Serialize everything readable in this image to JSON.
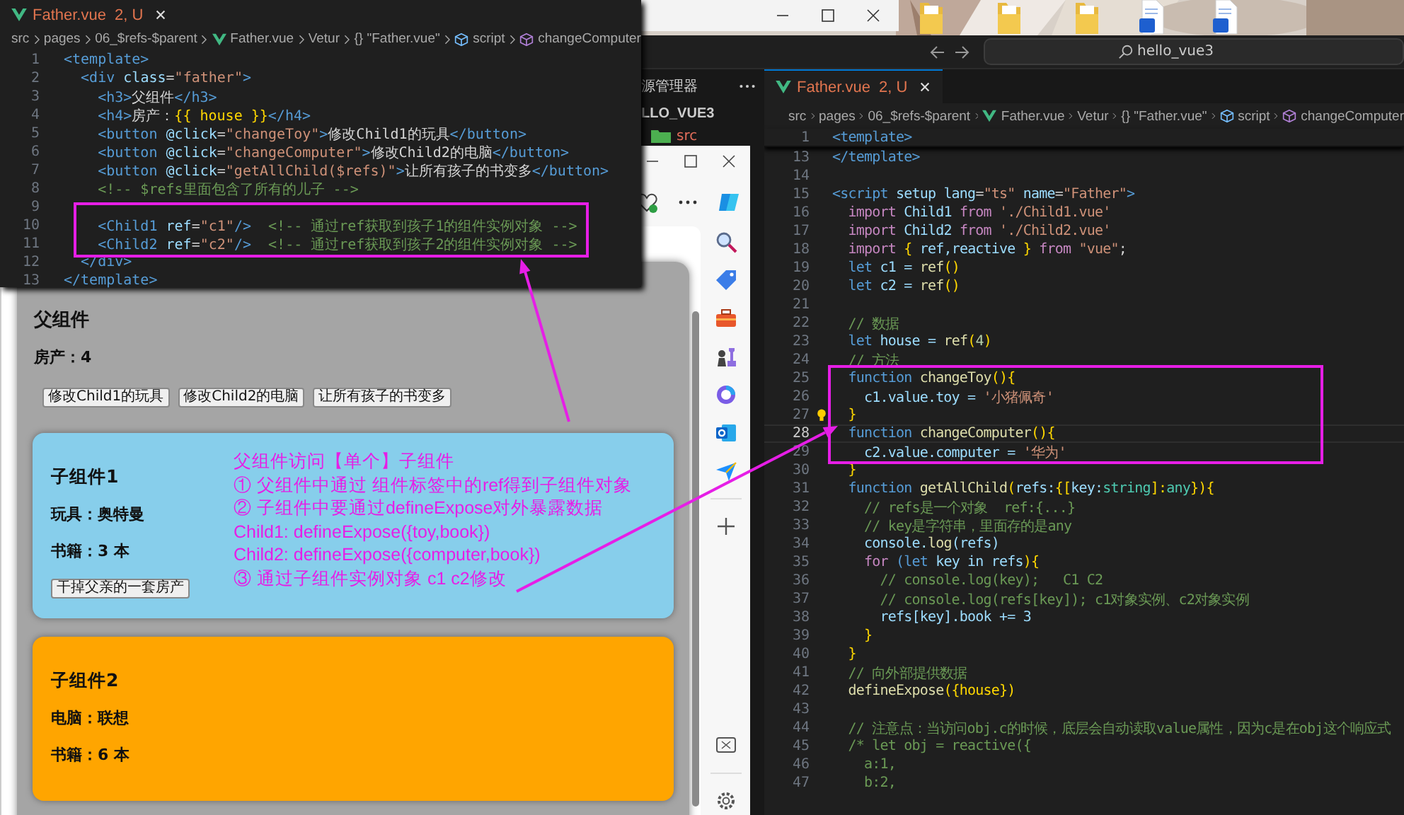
{
  "desktop_icons": [
    {
      "kind": "folder"
    },
    {
      "kind": "folder"
    },
    {
      "kind": "folder"
    },
    {
      "kind": "document"
    },
    {
      "kind": "document"
    }
  ],
  "vscode_window": {
    "search": "hello_vue3",
    "explorer": {
      "title": "源管理器",
      "project": "LLO_VUE3",
      "folder": "src"
    },
    "tab": {
      "name": "Father.vue",
      "status": "2, U"
    },
    "breadcrumb": [
      {
        "label": "src"
      },
      {
        "label": "pages"
      },
      {
        "label": "06_$refs-$parent"
      },
      {
        "label": "Father.vue",
        "kind": "vue"
      },
      {
        "label": "Vetur"
      },
      {
        "label": "{} \"Father.vue\""
      },
      {
        "label": "script",
        "kind": "script"
      },
      {
        "label": "changeComputer",
        "kind": "method"
      }
    ],
    "sticky_line": {
      "number": "1",
      "tokens": [
        {
          "text": "<template>",
          "kind": "tag"
        }
      ]
    },
    "lines": [
      {
        "number": "13",
        "active": false,
        "hint": false,
        "tokens": [
          {
            "text": "</template>",
            "kind": "tag"
          }
        ]
      },
      {
        "number": "14",
        "active": false,
        "hint": false
      },
      {
        "number": "15",
        "active": false,
        "hint": false,
        "tokens": [
          {
            "text": "<script ",
            "kind": "tag"
          },
          {
            "text": "setup lang",
            "kind": "attr"
          },
          {
            "text": "=",
            "kind": "text"
          },
          {
            "text": "\"ts\"",
            "kind": "str"
          },
          {
            "text": " name",
            "kind": "attr"
          },
          {
            "text": "=",
            "kind": "text"
          },
          {
            "text": "\"Father\"",
            "kind": "str"
          },
          {
            "text": ">",
            "kind": "tag"
          }
        ]
      },
      {
        "number": "16",
        "active": false,
        "hint": false,
        "tokens": [
          {
            "text": "  import ",
            "kind": "control"
          },
          {
            "text": "Child1 ",
            "kind": "var"
          },
          {
            "text": "from ",
            "kind": "control"
          },
          {
            "text": "'./Child1.vue'",
            "kind": "str"
          }
        ]
      },
      {
        "number": "17",
        "active": false,
        "hint": false,
        "tokens": [
          {
            "text": "  import ",
            "kind": "control"
          },
          {
            "text": "Child2 ",
            "kind": "var"
          },
          {
            "text": "from ",
            "kind": "control"
          },
          {
            "text": "'./Child2.vue'",
            "kind": "str"
          }
        ]
      },
      {
        "number": "18",
        "active": false,
        "hint": false,
        "tokens": [
          {
            "text": "  import ",
            "kind": "control"
          },
          {
            "text": "{ ",
            "kind": "brace"
          },
          {
            "text": "ref,reactive ",
            "kind": "var"
          },
          {
            "text": "} ",
            "kind": "brace"
          },
          {
            "text": "from ",
            "kind": "control"
          },
          {
            "text": "\"vue\"",
            "kind": "str"
          },
          {
            "text": ";",
            "kind": "text"
          }
        ]
      },
      {
        "number": "19",
        "active": false,
        "hint": false,
        "tokens": [
          {
            "text": "  let ",
            "kind": "keyword"
          },
          {
            "text": "c1 = ",
            "kind": "var"
          },
          {
            "text": "ref",
            "kind": "func"
          },
          {
            "text": "()",
            "kind": "brace"
          }
        ]
      },
      {
        "number": "20",
        "active": false,
        "hint": false,
        "tokens": [
          {
            "text": "  let ",
            "kind": "keyword"
          },
          {
            "text": "c2 = ",
            "kind": "var"
          },
          {
            "text": "ref",
            "kind": "func"
          },
          {
            "text": "()",
            "kind": "brace"
          }
        ]
      },
      {
        "number": "21",
        "active": false,
        "hint": false
      },
      {
        "number": "22",
        "active": false,
        "hint": false,
        "tokens": [
          {
            "text": "  // 数据",
            "kind": "comment"
          }
        ]
      },
      {
        "number": "23",
        "active": false,
        "hint": false,
        "tokens": [
          {
            "text": "  let ",
            "kind": "keyword"
          },
          {
            "text": "house = ",
            "kind": "var"
          },
          {
            "text": "ref",
            "kind": "func"
          },
          {
            "text": "(",
            "kind": "brace"
          },
          {
            "text": "4",
            "kind": "num"
          },
          {
            "text": ")",
            "kind": "brace"
          }
        ]
      },
      {
        "number": "24",
        "active": false,
        "hint": false,
        "tokens": [
          {
            "text": "  // 方法",
            "kind": "comment"
          }
        ]
      },
      {
        "number": "25",
        "active": false,
        "hint": false,
        "tokens": [
          {
            "text": "  function ",
            "kind": "keyword"
          },
          {
            "text": "changeToy",
            "kind": "func"
          },
          {
            "text": "(){",
            "kind": "brace"
          }
        ]
      },
      {
        "number": "26",
        "active": false,
        "hint": false,
        "tokens": [
          {
            "text": "    c1.value.toy = ",
            "kind": "var"
          },
          {
            "text": "'小猪佩奇'",
            "kind": "str"
          }
        ]
      },
      {
        "number": "27",
        "active": false,
        "hint": true,
        "tokens": [
          {
            "text": "  }",
            "kind": "brace"
          }
        ]
      },
      {
        "number": "28",
        "active": true,
        "hint": false,
        "tokens": [
          {
            "text": "  function ",
            "kind": "keyword"
          },
          {
            "text": "changeComputer",
            "kind": "func"
          },
          {
            "text": "(){",
            "kind": "brace"
          }
        ]
      },
      {
        "number": "29",
        "active": false,
        "hint": false,
        "tokens": [
          {
            "text": "    c2.value.computer = ",
            "kind": "var"
          },
          {
            "text": "'华为'",
            "kind": "str"
          }
        ]
      },
      {
        "number": "30",
        "active": false,
        "hint": false,
        "tokens": [
          {
            "text": "  }",
            "kind": "brace"
          }
        ]
      },
      {
        "number": "31",
        "active": false,
        "hint": false,
        "tokens": [
          {
            "text": "  function ",
            "kind": "keyword"
          },
          {
            "text": "getAllChild",
            "kind": "func"
          },
          {
            "text": "(",
            "kind": "brace"
          },
          {
            "text": "refs:",
            "kind": "var"
          },
          {
            "text": "{[",
            "kind": "brace"
          },
          {
            "text": "key:",
            "kind": "var"
          },
          {
            "text": "string",
            "kind": "type"
          },
          {
            "text": "]:",
            "kind": "brace"
          },
          {
            "text": "any",
            "kind": "type"
          },
          {
            "text": "}){",
            "kind": "brace"
          }
        ]
      },
      {
        "number": "32",
        "active": false,
        "hint": false,
        "tokens": [
          {
            "text": "    // refs是一个对象  ref:{...}",
            "kind": "comment"
          }
        ]
      },
      {
        "number": "33",
        "active": false,
        "hint": false,
        "tokens": [
          {
            "text": "    // key是字符串，里面存的是any",
            "kind": "comment"
          }
        ]
      },
      {
        "number": "34",
        "active": false,
        "hint": false,
        "tokens": [
          {
            "text": "    console.",
            "kind": "var"
          },
          {
            "text": "log",
            "kind": "func"
          },
          {
            "text": "(refs)",
            "kind": "var"
          }
        ]
      },
      {
        "number": "35",
        "active": false,
        "hint": false,
        "tokens": [
          {
            "text": "    for ",
            "kind": "control"
          },
          {
            "text": "(let ",
            "kind": "keyword"
          },
          {
            "text": "key in refs",
            "kind": "var"
          },
          {
            "text": "){",
            "kind": "brace"
          }
        ]
      },
      {
        "number": "36",
        "active": false,
        "hint": false,
        "tokens": [
          {
            "text": "      // console.log(key);   C1 C2",
            "kind": "comment"
          }
        ]
      },
      {
        "number": "37",
        "active": false,
        "hint": false,
        "tokens": [
          {
            "text": "      // console.log(refs[key]); c1对象实例、c2对象实例",
            "kind": "comment"
          }
        ]
      },
      {
        "number": "38",
        "active": false,
        "hint": false,
        "tokens": [
          {
            "text": "      refs[key].book += 3",
            "kind": "var"
          }
        ]
      },
      {
        "number": "39",
        "active": false,
        "hint": false,
        "tokens": [
          {
            "text": "    }",
            "kind": "brace"
          }
        ]
      },
      {
        "number": "40",
        "active": false,
        "hint": false,
        "tokens": [
          {
            "text": "  }",
            "kind": "brace"
          }
        ]
      },
      {
        "number": "41",
        "active": false,
        "hint": false,
        "tokens": [
          {
            "text": "  // 向外部提供数据",
            "kind": "comment"
          }
        ]
      },
      {
        "number": "42",
        "active": false,
        "hint": false,
        "tokens": [
          {
            "text": "  defineExpose",
            "kind": "func"
          },
          {
            "text": "({house})",
            "kind": "brace"
          }
        ]
      },
      {
        "number": "43",
        "active": false,
        "hint": false
      },
      {
        "number": "44",
        "active": false,
        "hint": false,
        "tokens": [
          {
            "text": "  // 注意点：当访问obj.c的时候，底层会自动读取value属性，因为c是在obj这个响应式",
            "kind": "comment"
          }
        ]
      },
      {
        "number": "45",
        "active": false,
        "hint": false,
        "tokens": [
          {
            "text": "  /* let obj = reactive({",
            "kind": "comment"
          }
        ]
      },
      {
        "number": "46",
        "active": false,
        "hint": false,
        "tokens": [
          {
            "text": "    a:1,",
            "kind": "comment"
          }
        ]
      },
      {
        "number": "47",
        "active": false,
        "hint": false,
        "tokens": [
          {
            "text": "    b:2,",
            "kind": "comment"
          }
        ]
      }
    ]
  },
  "browser_window": {
    "page": {
      "title": "父组件",
      "house": "房产：4",
      "buttons": [
        "修改Child1的玩具",
        "修改Child2的电脑",
        "让所有孩子的书变多"
      ],
      "children": [
        {
          "title": "子组件1",
          "color": "#87ceeb",
          "fields": [
            "玩具：奥特曼",
            "书籍：3 本"
          ],
          "button": "干掉父亲的一套房产"
        },
        {
          "title": "子组件2",
          "color": "#ffa500",
          "fields": [
            "电脑：联想",
            "书籍：6 本"
          ]
        }
      ]
    }
  },
  "snippet_window": {
    "tab": {
      "name": "Father.vue",
      "status": "2, U"
    },
    "breadcrumb": [
      {
        "label": "src"
      },
      {
        "label": "pages"
      },
      {
        "label": "06_$refs-$parent"
      },
      {
        "label": "Father.vue",
        "kind": "vue"
      },
      {
        "label": "Vetur"
      },
      {
        "label": "{} \"Father.vue\""
      },
      {
        "label": "script",
        "kind": "script"
      },
      {
        "label": "changeComputer",
        "kind": "method"
      }
    ],
    "lines": [
      {
        "number": "1",
        "tokens": [
          {
            "text": "<template>",
            "kind": "tag"
          }
        ]
      },
      {
        "number": "2",
        "tokens": [
          {
            "text": "  <div ",
            "kind": "tag"
          },
          {
            "text": "class",
            "kind": "attr"
          },
          {
            "text": "=",
            "kind": "text"
          },
          {
            "text": "\"father\"",
            "kind": "str"
          },
          {
            "text": ">",
            "kind": "tag"
          }
        ]
      },
      {
        "number": "3",
        "tokens": [
          {
            "text": "    <h3>",
            "kind": "tag"
          },
          {
            "text": "父组件",
            "kind": "text"
          },
          {
            "text": "</h3>",
            "kind": "tag"
          }
        ]
      },
      {
        "number": "4",
        "tokens": [
          {
            "text": "    <h4>",
            "kind": "tag"
          },
          {
            "text": "房产：",
            "kind": "text"
          },
          {
            "text": "{{ house }}",
            "kind": "brace"
          },
          {
            "text": "</h4>",
            "kind": "tag"
          }
        ]
      },
      {
        "number": "5",
        "tokens": [
          {
            "text": "    <button ",
            "kind": "tag"
          },
          {
            "text": "@click",
            "kind": "attr"
          },
          {
            "text": "=",
            "kind": "text"
          },
          {
            "text": "\"changeToy\"",
            "kind": "str"
          },
          {
            "text": ">",
            "kind": "tag"
          },
          {
            "text": "修改Child1的玩具",
            "kind": "text"
          },
          {
            "text": "</button>",
            "kind": "tag"
          }
        ]
      },
      {
        "number": "6",
        "tokens": [
          {
            "text": "    <button ",
            "kind": "tag"
          },
          {
            "text": "@click",
            "kind": "attr"
          },
          {
            "text": "=",
            "kind": "text"
          },
          {
            "text": "\"changeComputer\"",
            "kind": "str"
          },
          {
            "text": ">",
            "kind": "tag"
          },
          {
            "text": "修改Child2的电脑",
            "kind": "text"
          },
          {
            "text": "</button>",
            "kind": "tag"
          }
        ]
      },
      {
        "number": "7",
        "tokens": [
          {
            "text": "    <button ",
            "kind": "tag"
          },
          {
            "text": "@click",
            "kind": "attr"
          },
          {
            "text": "=",
            "kind": "text"
          },
          {
            "text": "\"getAllChild($refs)\"",
            "kind": "str"
          },
          {
            "text": ">",
            "kind": "tag"
          },
          {
            "text": "让所有孩子的书变多",
            "kind": "text"
          },
          {
            "text": "</button>",
            "kind": "tag"
          }
        ]
      },
      {
        "number": "8",
        "tokens": [
          {
            "text": "    <!-- $refs里面包含了所有的儿子 -->",
            "kind": "comment"
          }
        ]
      },
      {
        "number": "9"
      },
      {
        "number": "10",
        "tokens": [
          {
            "text": "    <Child1 ",
            "kind": "tag"
          },
          {
            "text": "ref",
            "kind": "attr"
          },
          {
            "text": "=",
            "kind": "text"
          },
          {
            "text": "\"c1\"",
            "kind": "str"
          },
          {
            "text": "/>",
            "kind": "tag"
          },
          {
            "text": "  <!-- 通过ref获取到孩子1的组件实例对象 -->",
            "kind": "comment"
          }
        ]
      },
      {
        "number": "11",
        "tokens": [
          {
            "text": "    <Child2 ",
            "kind": "tag"
          },
          {
            "text": "ref",
            "kind": "attr"
          },
          {
            "text": "=",
            "kind": "text"
          },
          {
            "text": "\"c2\"",
            "kind": "str"
          },
          {
            "text": "/>",
            "kind": "tag"
          },
          {
            "text": "  <!-- 通过ref获取到孩子2的组件实例对象 -->",
            "kind": "comment"
          }
        ]
      },
      {
        "number": "12",
        "tokens": [
          {
            "text": "  </div>",
            "kind": "tag"
          }
        ]
      },
      {
        "number": "13",
        "tokens": [
          {
            "text": "</template>",
            "kind": "tag"
          }
        ]
      }
    ]
  },
  "annotation": {
    "note_lines": [
      "父组件访问【单个】子组件",
      "① 父组件中通过 组件标签中的ref得到子组件对象",
      "② 子组件中要通过defineExpose对外暴露数据",
      "Child1: defineExpose({toy,book})",
      "Child2: defineExpose({computer,book})",
      "③ 通过子组件实例对象 c1 c2修改"
    ]
  }
}
